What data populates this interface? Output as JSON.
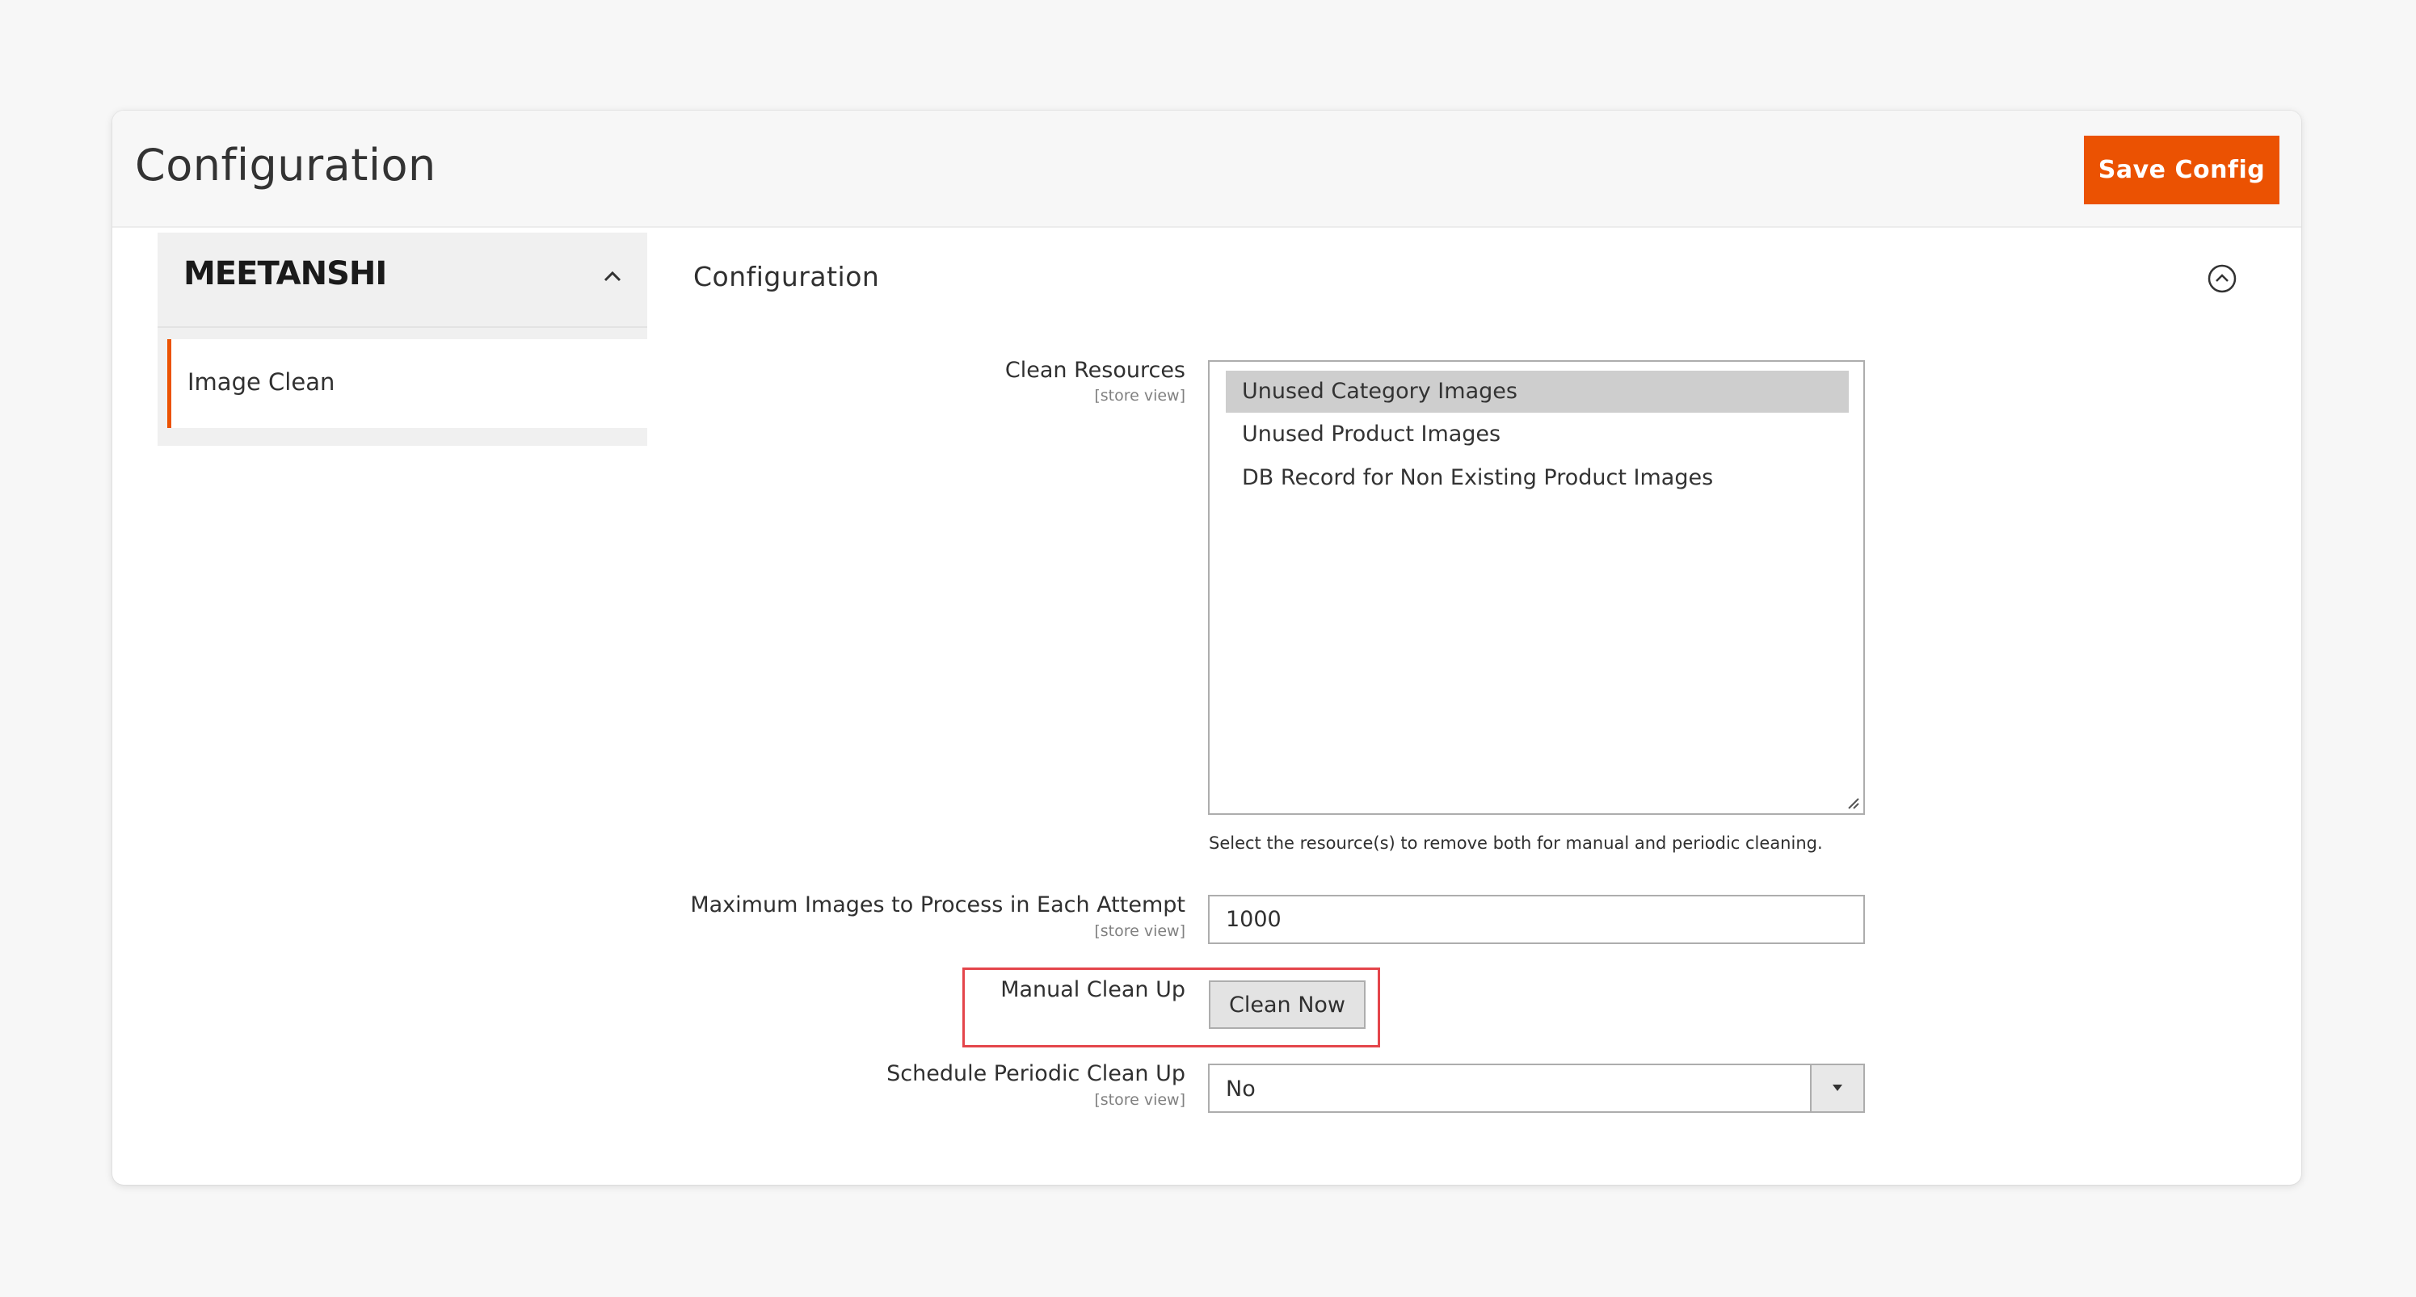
{
  "header": {
    "title": "Configuration",
    "save_label": "Save Config"
  },
  "sidebar": {
    "brand": "MEETANSHI",
    "items": [
      {
        "label": "Image Clean",
        "active": true
      }
    ]
  },
  "section": {
    "title": "Configuration"
  },
  "fields": {
    "clean_resources": {
      "label": "Clean Resources",
      "scope": "[store view]",
      "options": [
        {
          "label": "Unused Category Images",
          "selected": true
        },
        {
          "label": "Unused Product Images",
          "selected": false
        },
        {
          "label": "DB Record for Non Existing Product Images",
          "selected": false
        }
      ],
      "note": "Select the resource(s) to remove both for manual and periodic cleaning."
    },
    "max_images": {
      "label": "Maximum Images to Process in Each Attempt",
      "scope": "[store view]",
      "value": "1000"
    },
    "manual_clean": {
      "label": "Manual Clean Up",
      "button_label": "Clean Now"
    },
    "schedule": {
      "label": "Schedule Periodic Clean Up",
      "scope": "[store view]",
      "value": "No"
    }
  },
  "colors": {
    "accent": "#eb5202",
    "highlight": "#e4454b"
  }
}
